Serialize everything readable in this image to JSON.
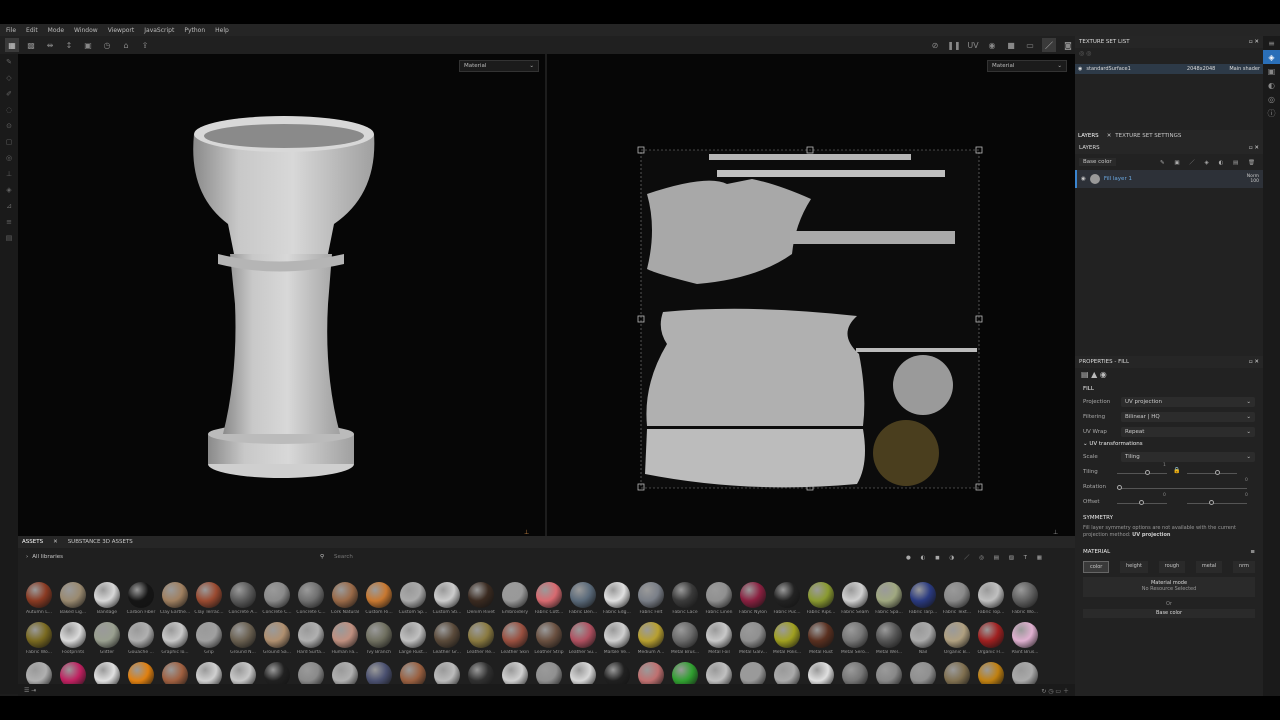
{
  "menu": [
    "File",
    "Edit",
    "Mode",
    "Window",
    "Viewport",
    "JavaScript",
    "Python",
    "Help"
  ],
  "viewport": {
    "left_select": "Material",
    "right_select": "Material"
  },
  "texture_set_list": {
    "title": "TEXTURE SET LIST",
    "name": "standardSurface1",
    "resolution": "2048x2048",
    "shader": "Main shader"
  },
  "layers_tabs": {
    "layers": "LAYERS",
    "settings": "TEXTURE SET SETTINGS"
  },
  "layers": {
    "title": "LAYERS",
    "channel": "Base color",
    "layer_name": "Fill layer 1",
    "blend": "Norm",
    "opacity": "100"
  },
  "properties": {
    "title": "PROPERTIES - FILL",
    "section": "FILL",
    "projection_label": "Projection",
    "projection": "UV projection",
    "filtering_label": "Filtering",
    "filtering": "Bilinear | HQ",
    "uvwrap_label": "UV Wrap",
    "uvwrap": "Repeat",
    "uvtrans": "UV transformations",
    "scale_label": "Scale",
    "scale": "Tiling",
    "tiling_label": "Tiling",
    "tiling_val": "1",
    "rotation_label": "Rotation",
    "rotation_val": "0",
    "offset_label": "Offset",
    "offset_a": "0",
    "offset_b": "0",
    "symmetry": "SYMMETRY",
    "sym_note": "Fill layer symmetry options are not available with the current projection method:",
    "sym_note_bold": "UV projection",
    "material": "MATERIAL",
    "channels": [
      "color",
      "height",
      "rough",
      "metal",
      "nrm"
    ],
    "material_mode": "Material mode",
    "no_resource": "No Resource Selected",
    "or": "Or",
    "base_color": "Base color"
  },
  "assets": {
    "tab1": "ASSETS",
    "tab2": "SUBSTANCE 3D ASSETS",
    "library": "All libraries",
    "search": "Search",
    "row1": [
      {
        "n": "Autumn L...",
        "c": "#8a3a22"
      },
      {
        "n": "Baked Lig...",
        "c": "#9a8a70"
      },
      {
        "n": "Bandage",
        "c": "#d8d8d8"
      },
      {
        "n": "Carbon Fiber",
        "c": "#151515"
      },
      {
        "n": "Clay Earthe...",
        "c": "#a08060"
      },
      {
        "n": "Clay Terrac...",
        "c": "#9a4a30"
      },
      {
        "n": "Concrete A...",
        "c": "#5a5a5a"
      },
      {
        "n": "Concrete C...",
        "c": "#8a8a8a"
      },
      {
        "n": "Concrete C...",
        "c": "#707070"
      },
      {
        "n": "Cork Natural",
        "c": "#9a6a48"
      },
      {
        "n": "Custom Ri...",
        "c": "#c87830"
      },
      {
        "n": "Custom Sp...",
        "c": "#aaaaaa"
      },
      {
        "n": "Custom Sti...",
        "c": "#cccccc"
      },
      {
        "n": "Denim Rivet",
        "c": "#3a2a20"
      },
      {
        "n": "Embroidery",
        "c": "#999999"
      },
      {
        "n": "Fabric Cott...",
        "c": "#d86a70"
      },
      {
        "n": "Fabric Den...",
        "c": "#5a6a7a"
      },
      {
        "n": "Fabric Edg...",
        "c": "#e0e0e0"
      },
      {
        "n": "Fabric Felt",
        "c": "#7a7f88"
      },
      {
        "n": "Fabric Lace",
        "c": "#3a3a3a"
      },
      {
        "n": "Fabric Linen",
        "c": "#909090"
      },
      {
        "n": "Fabric Nylon",
        "c": "#8a2040"
      },
      {
        "n": "Fabric Puc...",
        "c": "#222222"
      },
      {
        "n": "Fabric Rips...",
        "c": "#8a9a30"
      },
      {
        "n": "Fabric Seam",
        "c": "#d0d0d0"
      },
      {
        "n": "Fabric Spa...",
        "c": "#a0a880"
      },
      {
        "n": "Fabric Tarp...",
        "c": "#2a3a80"
      },
      {
        "n": "Fabric Text...",
        "c": "#8a8a8a"
      },
      {
        "n": "Fabric Top...",
        "c": "#c0c0c0"
      },
      {
        "n": "Fabric Wo...",
        "c": "#606060"
      }
    ],
    "row2": [
      {
        "n": "Fabric Wo...",
        "c": "#7a6a20"
      },
      {
        "n": "Footprints",
        "c": "#dadada"
      },
      {
        "n": "Glitter",
        "c": "#9aa090"
      },
      {
        "n": "Gouache ...",
        "c": "#b0b0b0"
      },
      {
        "n": "Graphic lo...",
        "c": "#c8c8c8"
      },
      {
        "n": "Grip",
        "c": "#a0a0a0"
      },
      {
        "n": "Ground N...",
        "c": "#6a6050"
      },
      {
        "n": "Ground Sa...",
        "c": "#b09070"
      },
      {
        "n": "Hard Surfa...",
        "c": "#b0b0b0"
      },
      {
        "n": "Human Fa...",
        "c": "#c09080"
      },
      {
        "n": "Ivy Branch",
        "c": "#707060"
      },
      {
        "n": "Large Rust...",
        "c": "#c0c0c0"
      },
      {
        "n": "Leather Gr...",
        "c": "#5a4a3a"
      },
      {
        "n": "Leather Re...",
        "c": "#8a7a40"
      },
      {
        "n": "Leather Skin",
        "c": "#9a5040"
      },
      {
        "n": "Leather Strip",
        "c": "#6a5040"
      },
      {
        "n": "Leather Su...",
        "c": "#b05060"
      },
      {
        "n": "Marble Ve...",
        "c": "#d0d0d0"
      },
      {
        "n": "Medium A...",
        "c": "#b8a030"
      },
      {
        "n": "Metal Brus...",
        "c": "#6a6a6a"
      },
      {
        "n": "Metal Foil",
        "c": "#c8c8c8"
      },
      {
        "n": "Metal Galv...",
        "c": "#909090"
      },
      {
        "n": "Metal Polis...",
        "c": "#a0a020"
      },
      {
        "n": "Metal Rust",
        "c": "#5a3020"
      },
      {
        "n": "Metal Sero...",
        "c": "#777777"
      },
      {
        "n": "Metal Wel...",
        "c": "#555555"
      },
      {
        "n": "Nail",
        "c": "#aaaaaa"
      },
      {
        "n": "Organic B...",
        "c": "#b0a080"
      },
      {
        "n": "Organic Fl...",
        "c": "#a02020"
      },
      {
        "n": "Paint Brus...",
        "c": "#e0b0d0"
      }
    ],
    "row3": [
      {
        "n": "",
        "c": "#b0b0b0"
      },
      {
        "n": "",
        "c": "#c02060"
      },
      {
        "n": "",
        "c": "#e0e0e0"
      },
      {
        "n": "",
        "c": "#e08010"
      },
      {
        "n": "",
        "c": "#a06040"
      },
      {
        "n": "",
        "c": "#d0d0d0"
      },
      {
        "n": "",
        "c": "#c8c8c8"
      },
      {
        "n": "",
        "c": "#202020"
      },
      {
        "n": "",
        "c": "#8a8a8a"
      },
      {
        "n": "",
        "c": "#b0b0b0"
      },
      {
        "n": "",
        "c": "#4a5070"
      },
      {
        "n": "",
        "c": "#9a6040"
      },
      {
        "n": "",
        "c": "#bbbbbb"
      },
      {
        "n": "",
        "c": "#303030"
      },
      {
        "n": "",
        "c": "#d0d0d0"
      },
      {
        "n": "",
        "c": "#909090"
      },
      {
        "n": "",
        "c": "#d8d8d8"
      },
      {
        "n": "",
        "c": "#202020"
      },
      {
        "n": "",
        "c": "#c07070"
      },
      {
        "n": "",
        "c": "#30a030"
      },
      {
        "n": "",
        "c": "#c0c0c0"
      },
      {
        "n": "",
        "c": "#9a9a9a"
      },
      {
        "n": "",
        "c": "#aaaaaa"
      },
      {
        "n": "",
        "c": "#e0e0e0"
      },
      {
        "n": "",
        "c": "#777777"
      },
      {
        "n": "",
        "c": "#888888"
      },
      {
        "n": "",
        "c": "#909090"
      },
      {
        "n": "",
        "c": "#807050"
      },
      {
        "n": "",
        "c": "#c08010"
      },
      {
        "n": "",
        "c": "#aaaaaa"
      }
    ]
  }
}
